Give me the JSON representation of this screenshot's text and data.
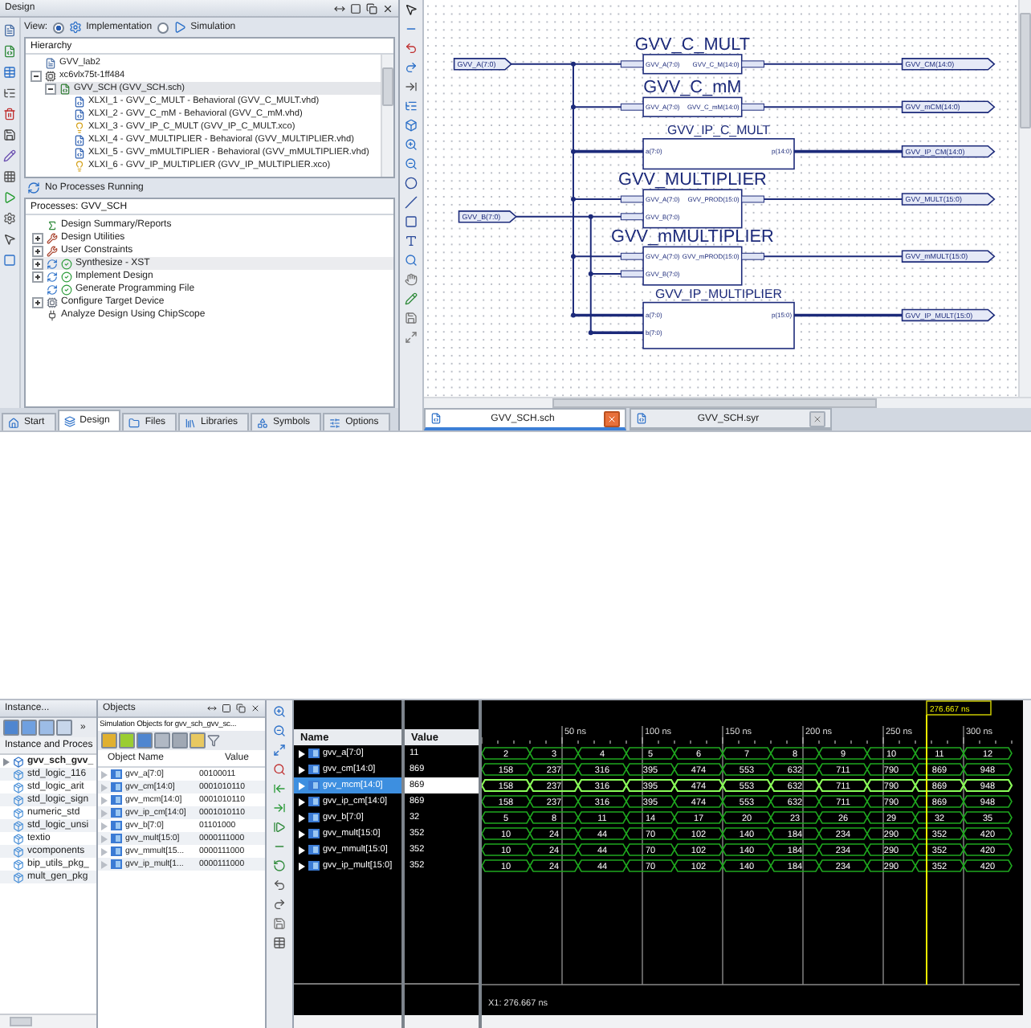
{
  "design": {
    "title": "Design",
    "view_label": "View:",
    "view_options": [
      {
        "label": "Implementation",
        "selected": true
      },
      {
        "label": "Simulation",
        "selected": false
      }
    ],
    "hierarchy_title": "Hierarchy",
    "hierarchy": [
      {
        "label": "GVV_lab2",
        "kind": "project",
        "selected": false
      },
      {
        "label": "xc6vlx75t-1ff484",
        "kind": "device",
        "selected": false,
        "expanded": true,
        "children": [
          {
            "label": "GVV_SCH (GVV_SCH.sch)",
            "kind": "schematic",
            "selected": true,
            "expanded": true,
            "children": [
              {
                "label": "XLXI_1 - GVV_C_MULT - Behavioral (GVV_C_MULT.vhd)",
                "kind": "vhdl",
                "selected": false
              },
              {
                "label": "XLXI_2 - GVV_C_mM - Behavioral (GVV_C_mM.vhd)",
                "kind": "vhdl",
                "selected": false
              },
              {
                "label": "XLXI_3 - GVV_IP_C_MULT (GVV_IP_C_MULT.xco)",
                "kind": "core",
                "selected": false
              },
              {
                "label": "XLXI_4 - GVV_MULTIPLIER - Behavioral (GVV_MULTIPLIER.vhd)",
                "kind": "vhdl",
                "selected": false
              },
              {
                "label": "XLXI_5 - GVV_mMULTIPLIER - Behavioral (GVV_mMULTIPLIER.vhd)",
                "kind": "vhdl",
                "selected": false
              },
              {
                "label": "XLXI_6 - GVV_IP_MULTIPLIER (GVV_IP_MULTIPLIER.xco)",
                "kind": "core",
                "selected": false
              }
            ]
          }
        ]
      }
    ],
    "status": "No Processes Running",
    "processes_title": "Processes: GVV_SCH",
    "processes": [
      {
        "label": "Design Summary/Reports",
        "kind": "summary",
        "selected": false,
        "done": false
      },
      {
        "label": "Design Utilities",
        "kind": "tools",
        "selected": false,
        "done": false,
        "expanded": false
      },
      {
        "label": "User Constraints",
        "kind": "tools",
        "selected": false,
        "done": false,
        "expanded": false
      },
      {
        "label": "Synthesize - XST",
        "kind": "run",
        "selected": true,
        "done": true,
        "expanded": false
      },
      {
        "label": "Implement Design",
        "kind": "run",
        "selected": false,
        "done": true,
        "expanded": false
      },
      {
        "label": "Generate Programming File",
        "kind": "run",
        "selected": false,
        "done": true
      },
      {
        "label": "Configure Target Device",
        "kind": "device",
        "selected": false,
        "done": false,
        "expanded": false
      },
      {
        "label": "Analyze Design Using ChipScope",
        "kind": "probe",
        "selected": false,
        "done": false
      }
    ],
    "tabs": [
      {
        "label": "Start",
        "selected": false
      },
      {
        "label": "Design",
        "selected": true
      },
      {
        "label": "Files",
        "selected": false
      },
      {
        "label": "Libraries",
        "selected": false
      },
      {
        "label": "Symbols",
        "selected": false
      },
      {
        "label": "Options",
        "selected": false
      }
    ]
  },
  "schematic": {
    "input_ports": [
      "GVV_A(7:0)",
      "GVV_B(7:0)"
    ],
    "blocks": [
      {
        "title": "GVV_C_MULT",
        "kind": "module",
        "inputs": [
          "GVV_A(7:0)"
        ],
        "output": "GVV_C_M(14:0)",
        "net": "GVV_CM(14:0)"
      },
      {
        "title": "GVV_C_mM",
        "kind": "module",
        "inputs": [
          "GVV_A(7:0)"
        ],
        "output": "GVV_C_mM(14:0)",
        "net": "GVV_mCM(14:0)"
      },
      {
        "title": "GVV_IP_C_MULT",
        "kind": "core",
        "inputs": [
          "a(7:0)"
        ],
        "output": "p(14:0)",
        "net": "GVV_IP_CM(14:0)"
      },
      {
        "title": "GVV_MULTIPLIER",
        "kind": "module",
        "inputs": [
          "GVV_A(7:0)",
          "GVV_B(7:0)"
        ],
        "output": "GVV_PROD(15:0)",
        "net": "GVV_MULT(15:0)"
      },
      {
        "title": "GVV_mMULTIPLIER",
        "kind": "module",
        "inputs": [
          "GVV_A(7:0)",
          "GVV_B(7:0)"
        ],
        "output": "GVV_mPROD(15:0)",
        "net": "GVV_mMULT(15:0)"
      },
      {
        "title": "GVV_IP_MULTIPLIER",
        "kind": "core",
        "inputs": [
          "a(7:0)",
          "b(7:0)"
        ],
        "output": "p(15:0)",
        "net": "GVV_IP_MULT(15:0)"
      }
    ],
    "file_tabs": [
      {
        "label": "GVV_SCH.sch",
        "selected": true
      },
      {
        "label": "GVV_SCH.syr",
        "selected": false
      }
    ]
  },
  "simulator": {
    "instances": {
      "title": "Instance...",
      "overflow": "»",
      "header": "Instance and Proces",
      "items": [
        {
          "label": "gvv_sch_gvv_",
          "kind": "module",
          "expanded": false
        },
        {
          "label": "std_logic_116",
          "kind": "package"
        },
        {
          "label": "std_logic_arit",
          "kind": "package"
        },
        {
          "label": "std_logic_sign",
          "kind": "package"
        },
        {
          "label": "numeric_std",
          "kind": "package"
        },
        {
          "label": "std_logic_unsi",
          "kind": "package"
        },
        {
          "label": "textio",
          "kind": "package"
        },
        {
          "label": "vcomponents",
          "kind": "package"
        },
        {
          "label": "bip_utils_pkg_",
          "kind": "package"
        },
        {
          "label": "mult_gen_pkg",
          "kind": "package"
        }
      ]
    },
    "objects": {
      "title": "Objects",
      "subtitle": "Simulation Objects for gvv_sch_gvv_sc...",
      "columns": [
        "Object Name",
        "Value"
      ],
      "rows": [
        {
          "name": "gvv_a[7:0]",
          "value": "00100011"
        },
        {
          "name": "gvv_cm[14:0]",
          "value": "0001010110"
        },
        {
          "name": "gvv_mcm[14:0]",
          "value": "0001010110"
        },
        {
          "name": "gvv_ip_cm[14:0]",
          "value": "0001010110"
        },
        {
          "name": "gvv_b[7:0]",
          "value": "01101000"
        },
        {
          "name": "gvv_mult[15:0]",
          "value": "0000111000"
        },
        {
          "name": "gvv_mmult[15...",
          "value": "0000111000"
        },
        {
          "name": "gvv_ip_mult[1...",
          "value": "0000111000"
        }
      ]
    },
    "waveform": {
      "columns": [
        "Name",
        "Value"
      ],
      "cursor_label": "276.667 ns",
      "time_labels": [
        "50 ns",
        "100 ns",
        "150 ns",
        "200 ns",
        "250 ns",
        "300 ns"
      ],
      "readout": "X1: 276.667 ns",
      "signals": [
        {
          "name": "gvv_a[7:0]",
          "value": "11",
          "selected": false,
          "segments": [
            "2",
            "3",
            "4",
            "5",
            "6",
            "7",
            "8",
            "9",
            "10",
            "11",
            "12"
          ]
        },
        {
          "name": "gvv_cm[14:0]",
          "value": "869",
          "selected": false,
          "segments": [
            "158",
            "237",
            "316",
            "395",
            "474",
            "553",
            "632",
            "711",
            "790",
            "869",
            "948"
          ]
        },
        {
          "name": "gvv_mcm[14:0]",
          "value": "869",
          "selected": true,
          "segments": [
            "158",
            "237",
            "316",
            "395",
            "474",
            "553",
            "632",
            "711",
            "790",
            "869",
            "948"
          ]
        },
        {
          "name": "gvv_ip_cm[14:0]",
          "value": "869",
          "selected": false,
          "segments": [
            "158",
            "237",
            "316",
            "395",
            "474",
            "553",
            "632",
            "711",
            "790",
            "869",
            "948"
          ]
        },
        {
          "name": "gvv_b[7:0]",
          "value": "32",
          "selected": false,
          "segments": [
            "5",
            "8",
            "11",
            "14",
            "17",
            "20",
            "23",
            "26",
            "29",
            "32",
            "35"
          ]
        },
        {
          "name": "gvv_mult[15:0]",
          "value": "352",
          "selected": false,
          "segments": [
            "10",
            "24",
            "44",
            "70",
            "102",
            "140",
            "184",
            "234",
            "290",
            "352",
            "420"
          ]
        },
        {
          "name": "gvv_mmult[15:0]",
          "value": "352",
          "selected": false,
          "segments": [
            "10",
            "24",
            "44",
            "70",
            "102",
            "140",
            "184",
            "234",
            "290",
            "352",
            "420"
          ]
        },
        {
          "name": "gvv_ip_mult[15:0]",
          "value": "352",
          "selected": false,
          "segments": [
            "10",
            "24",
            "44",
            "70",
            "102",
            "140",
            "184",
            "234",
            "290",
            "352",
            "420"
          ]
        }
      ]
    }
  }
}
